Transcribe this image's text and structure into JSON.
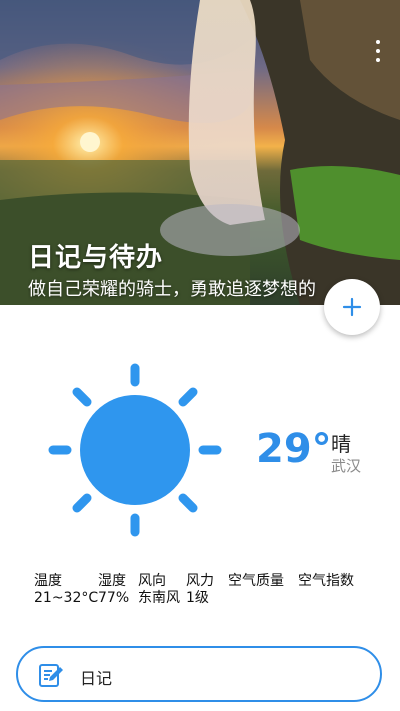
{
  "header": {
    "title": "日记与待办",
    "subtitle": "做自己荣耀的骑士，勇敢追逐梦想的",
    "menu_icon": "more-vert-icon",
    "add_icon": "plus-icon",
    "hero_image": "waterfall-sunset-landscape"
  },
  "weather": {
    "icon": "sun-icon",
    "temperature": "29°",
    "condition": "晴",
    "city": "武汉",
    "stats": [
      {
        "label": "温度",
        "value": "21~32°C"
      },
      {
        "label": "湿度",
        "value": "77%"
      },
      {
        "label": "风向",
        "value": "东南风"
      },
      {
        "label": "风力",
        "value": "1级"
      },
      {
        "label": "空气质量",
        "value": ""
      },
      {
        "label": "空气指数",
        "value": ""
      }
    ]
  },
  "actions": {
    "diary_label": "日记",
    "diary_icon": "edit-note-icon"
  },
  "colors": {
    "accent": "#2f8ee8",
    "sun": "#2f96ee",
    "text": "#111111",
    "muted": "#8a8a8a"
  }
}
